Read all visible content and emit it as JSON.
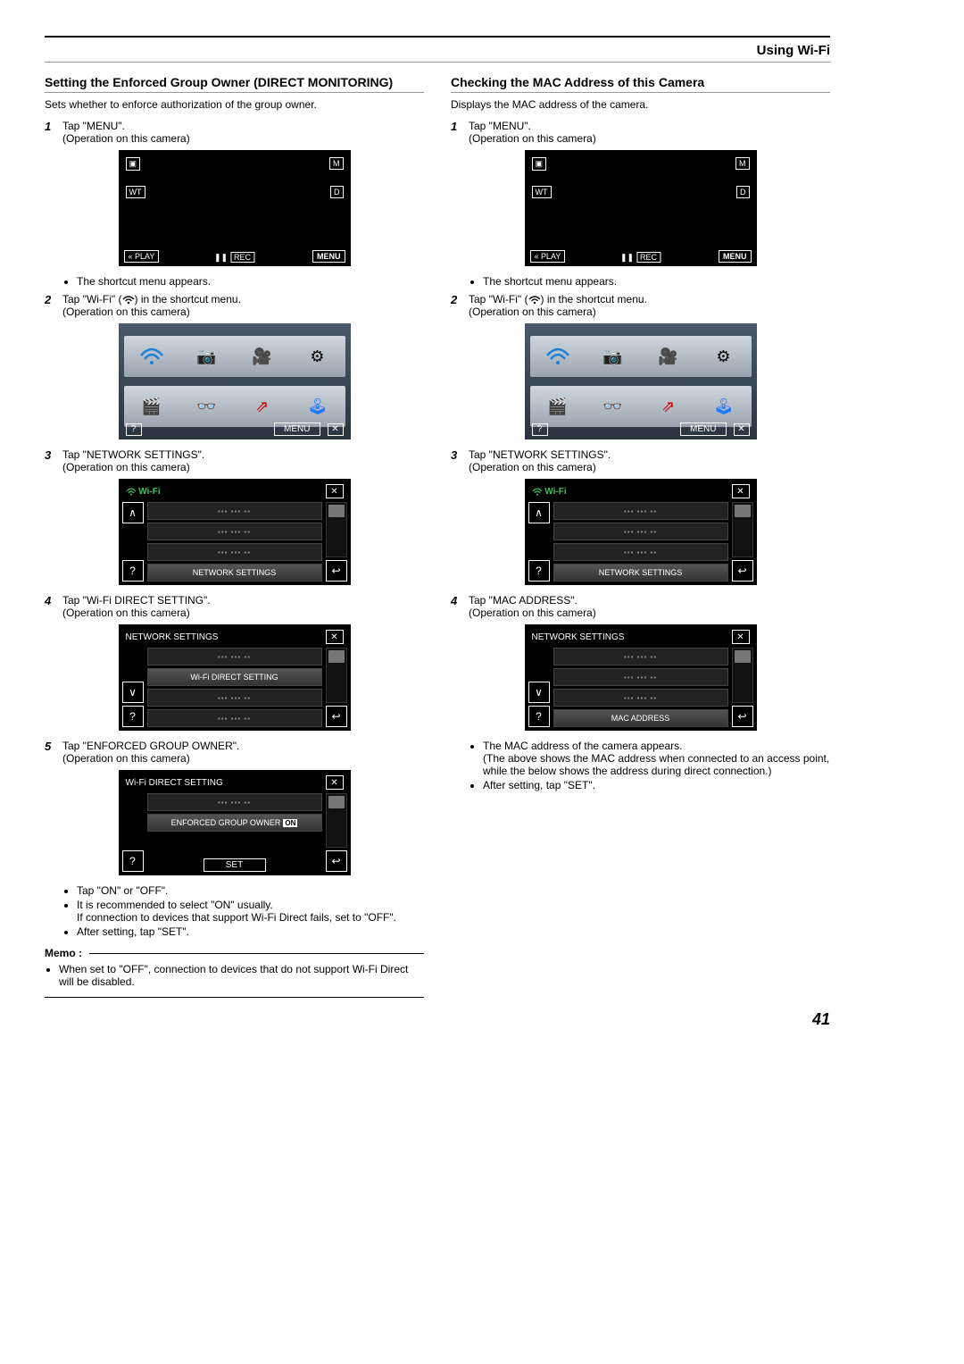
{
  "header": {
    "section": "Using Wi-Fi"
  },
  "page_number": "41",
  "left": {
    "title": "Setting the Enforced Group Owner (DIRECT MONITORING)",
    "desc": "Sets whether to enforce authorization of the group owner.",
    "steps": {
      "s1": {
        "num": "1",
        "text": "Tap \"MENU\".",
        "sub": "(Operation on this camera)"
      },
      "s1_bullet": "The shortcut menu appears.",
      "s2": {
        "num": "2",
        "text": "Tap \"Wi-Fi\" (",
        "text2": ") in the shortcut menu.",
        "sub": "(Operation on this camera)"
      },
      "s3": {
        "num": "3",
        "text": "Tap \"NETWORK SETTINGS\".",
        "sub": "(Operation on this camera)"
      },
      "s4": {
        "num": "4",
        "text": "Tap \"Wi-Fi DIRECT SETTING\".",
        "sub": "(Operation on this camera)"
      },
      "s5": {
        "num": "5",
        "text": "Tap \"ENFORCED GROUP OWNER\".",
        "sub": "(Operation on this camera)"
      },
      "post_bullets": [
        "Tap \"ON\" or \"OFF\".",
        "It is recommended to select \"ON\" usually.\nIf connection to devices that support Wi-Fi Direct fails, set to \"OFF\".",
        "After setting, tap \"SET\"."
      ]
    },
    "fig_rec": {
      "m": "M",
      "d": "D",
      "wt": "WT",
      "play": "PLAY",
      "rec": "REC",
      "menu": "MENU"
    },
    "fig_shortcut": {
      "menu": "MENU"
    },
    "fig_wifi": {
      "title": "Wi-Fi",
      "item": "NETWORK SETTINGS"
    },
    "fig_net": {
      "title": "NETWORK SETTINGS",
      "item": "Wi-Fi DIRECT SETTING"
    },
    "fig_direct": {
      "title": "Wi-Fi DIRECT SETTING",
      "item": "ENFORCED GROUP OWNER",
      "on": "ON",
      "set": "SET"
    },
    "memo": {
      "label": "Memo :",
      "text": "When set to \"OFF\", connection to devices that do not support Wi-Fi Direct will be disabled."
    }
  },
  "right": {
    "title": "Checking the MAC Address of this Camera",
    "desc": "Displays the MAC address of the camera.",
    "steps": {
      "s1": {
        "num": "1",
        "text": "Tap \"MENU\".",
        "sub": "(Operation on this camera)"
      },
      "s1_bullet": "The shortcut menu appears.",
      "s2": {
        "num": "2",
        "text": "Tap \"Wi-Fi\" (",
        "text2": ") in the shortcut menu.",
        "sub": "(Operation on this camera)"
      },
      "s3": {
        "num": "3",
        "text": "Tap \"NETWORK SETTINGS\".",
        "sub": "(Operation on this camera)"
      },
      "s4": {
        "num": "4",
        "text": "Tap \"MAC ADDRESS\".",
        "sub": "(Operation on this camera)"
      },
      "post_bullets": [
        "The MAC address of the camera appears.\n(The above shows the MAC address when connected to an access point, while the below shows the address during direct connection.)",
        "After setting, tap \"SET\"."
      ]
    },
    "fig_rec": {
      "m": "M",
      "d": "D",
      "wt": "WT",
      "play": "PLAY",
      "rec": "REC",
      "menu": "MENU"
    },
    "fig_shortcut": {
      "menu": "MENU"
    },
    "fig_wifi": {
      "title": "Wi-Fi",
      "item": "NETWORK SETTINGS"
    },
    "fig_net": {
      "title": "NETWORK SETTINGS",
      "item": "MAC ADDRESS"
    }
  }
}
